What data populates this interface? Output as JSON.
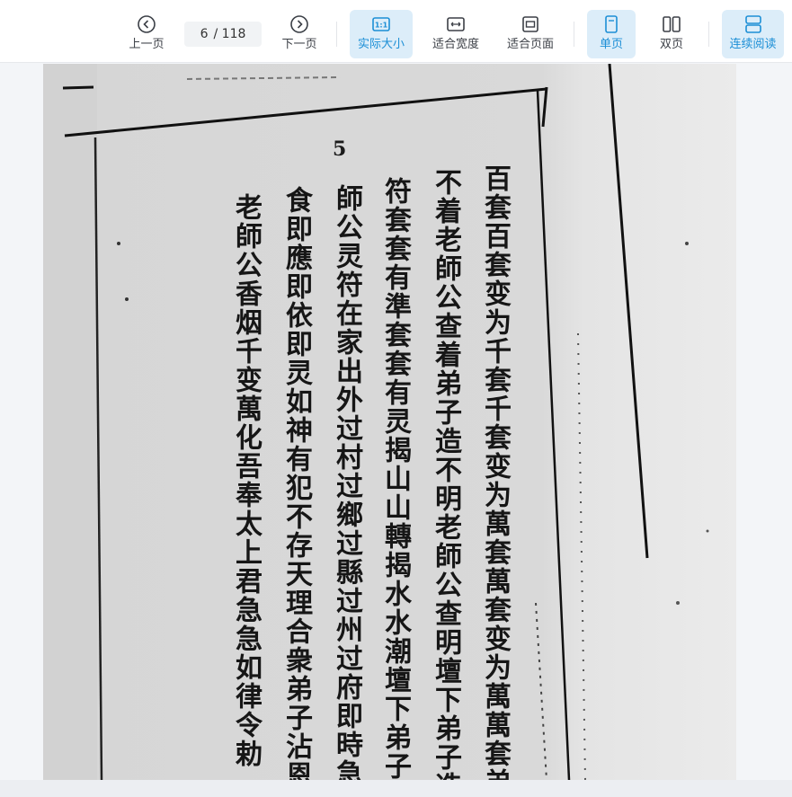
{
  "toolbar": {
    "prev_label": "上一页",
    "next_label": "下一页",
    "current_page": "6",
    "total_pages": "/ 118",
    "actual_size_label": "实际大小",
    "fit_width_label": "适合宽度",
    "fit_page_label": "适合页面",
    "single_page_label": "单页",
    "double_page_label": "双页",
    "continuous_label": "连续阅读",
    "actual_size_icon_text": "1:1"
  },
  "colors": {
    "accent": "#1d8fd6",
    "active_bg": "#dcedf9",
    "paper": "#d9d9d9",
    "ink": "#161616"
  },
  "document": {
    "page_number": "5",
    "columns": [
      "百套百套变为千套千套变为萬套萬套变为萬萬套弟子",
      "不着老師公查着弟子造不明老師公查明壇下弟子造有",
      "符套套有準套套有灵揭山山轉揭水水潮壇下弟子合",
      "師公灵符在家出外过村过鄉过縣过州过府即時急",
      "食即應即依即灵如神有犯不存天理合衆弟子沾恩",
      "老師公香烟千变萬化吾奉太上君急急如律令勅"
    ]
  }
}
